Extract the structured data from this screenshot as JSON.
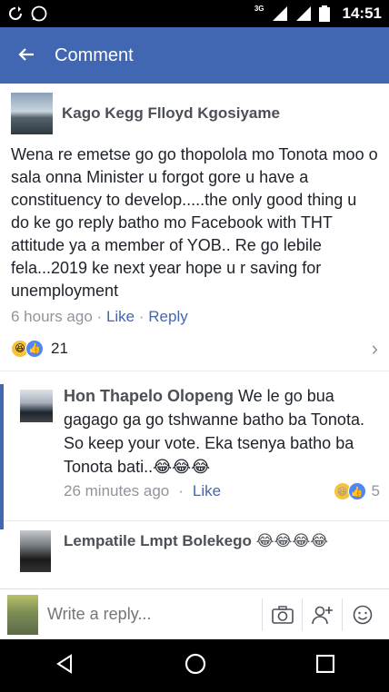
{
  "status_bar": {
    "network_badge": "3G",
    "time": "14:51"
  },
  "app_bar": {
    "title": "Comment",
    "back_icon": "arrow-left-icon"
  },
  "comment": {
    "author": "Kago Kegg Flloyd Kgosiyame",
    "text": "Wena re emetse go go thopolola mo Tonota moo o sala onna Minister u forgot gore u have a constituency to develop.....the only good thing u do ke go reply batho mo Facebook with THT attitude ya a member of YOB.. Re go lebile fela...2019 ke next year hope u r saving for unemployment",
    "time": "6 hours ago",
    "separator": "·",
    "like_label": "Like",
    "reply_label": "Reply",
    "reaction_count": "21"
  },
  "reply": {
    "author": "Hon Thapelo Olopeng",
    "text": " We le go bua gagago ga go tshwanne batho ba Tonota. So keep your vote.  Eka tsenya batho ba Tonota bati..😂😂😂",
    "time": "26 minutes ago",
    "separator": "·",
    "like_label": "Like",
    "reaction_count": "5"
  },
  "reply2": {
    "author": "Lempatile Lmpt Bolekego",
    "emojis": "😂😂😂😂"
  },
  "composer": {
    "placeholder": "Write a reply..."
  },
  "colors": {
    "brand": "#4267b2",
    "meta_gray": "#90949c",
    "text": "#1d2129"
  }
}
